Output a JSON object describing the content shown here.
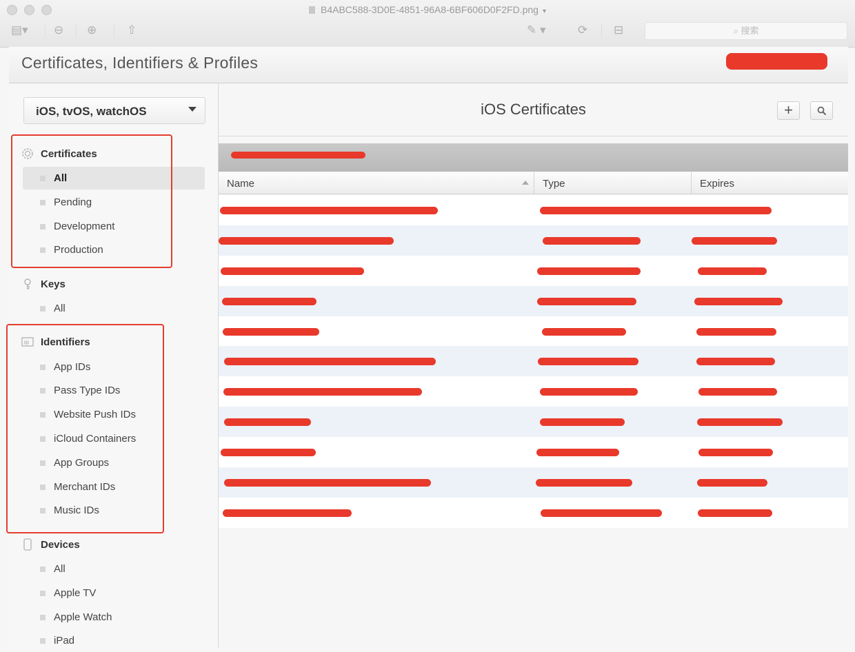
{
  "window": {
    "filename": "B4ABC588-3D0E-4851-96A8-6BF606D0F2FD.png",
    "search_placeholder": "搜索"
  },
  "page": {
    "title": "Certificates, Identifiers & Profiles"
  },
  "sidebar": {
    "platform": "iOS, tvOS, watchOS",
    "certificates": {
      "label": "Certificates",
      "items": [
        "All",
        "Pending",
        "Development",
        "Production"
      ]
    },
    "keys": {
      "label": "Keys",
      "items": [
        "All"
      ]
    },
    "identifiers": {
      "label": "Identifiers",
      "items": [
        "App IDs",
        "Pass Type IDs",
        "Website Push IDs",
        "iCloud Containers",
        "App Groups",
        "Merchant IDs",
        "Music IDs"
      ]
    },
    "devices": {
      "label": "Devices",
      "items": [
        "All",
        "Apple TV",
        "Apple Watch",
        "iPad"
      ]
    }
  },
  "main": {
    "title": "iOS Certificates",
    "add_label": "+",
    "columns": {
      "name": "Name",
      "type": "Type",
      "expires": "Expires"
    }
  },
  "colors": {
    "annotation": "#e43d2f",
    "redaction": "#e8392b"
  }
}
